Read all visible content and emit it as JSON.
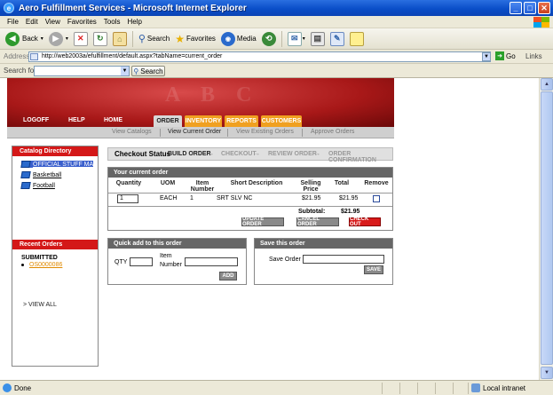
{
  "window": {
    "title": "Aero Fulfillment Services - Microsoft Internet Explorer",
    "minimize": "_",
    "maximize": "□",
    "close": "✕"
  },
  "menu": [
    "File",
    "Edit",
    "View",
    "Favorites",
    "Tools",
    "Help"
  ],
  "toolbar": {
    "back": "Back",
    "search": "Search",
    "favorites": "Favorites",
    "media": "Media"
  },
  "address": {
    "label": "Address",
    "url": "http://web2003a/efulfillment/default.aspx?tabName=current_order",
    "go": "Go",
    "links": "Links"
  },
  "searchbar": {
    "label": "Search for",
    "button": "Search"
  },
  "site": {
    "topnav": [
      "LOGOFF",
      "HELP",
      "HOME"
    ],
    "tabs": [
      "ORDER",
      "INVENTORY",
      "REPORTS",
      "CUSTOMERS"
    ],
    "subnav": [
      "View Catalogs",
      "View Current Order",
      "View Existing Orders",
      "Approve Orders"
    ]
  },
  "catalog": {
    "title": "Catalog Directory",
    "items": [
      "OFFICIAL STUFF MA",
      "Basketball",
      "Football"
    ]
  },
  "recent": {
    "title": "Recent Orders",
    "submitted_label": "SUBMITTED",
    "order_number": "OS0000086",
    "view_all": "> VIEW ALL"
  },
  "checkout": {
    "title": "Checkout Status",
    "steps": [
      "BUILD ORDER",
      "CHECKOUT",
      "REVIEW ORDER",
      "ORDER CONFIRMATION"
    ],
    "arrow": "→"
  },
  "order": {
    "title": "Your current order",
    "columns": [
      "Quantity",
      "UOM",
      "Item Number",
      "Short Description",
      "Selling Price",
      "Total",
      "Remove"
    ],
    "rows": [
      {
        "quantity": "1",
        "uom": "EACH",
        "item_number": "1",
        "description": "SRT SLV NC",
        "price": "$21.95",
        "total": "$21.95"
      }
    ],
    "subtotal_label": "Subtotal:",
    "subtotal": "$21.95",
    "update": "UPDATE ORDER",
    "cancel": "CANCEL ORDER",
    "checkout": "CHECK OUT"
  },
  "quickadd": {
    "title": "Quick add to this order",
    "qty_label": "QTY",
    "item_label_1": "Item",
    "item_label_2": "Number",
    "add": "ADD"
  },
  "save": {
    "title": "Save this order",
    "label": "Save Order",
    "button": "SAVE"
  },
  "status": {
    "text": "Done",
    "zone": "Local intranet"
  }
}
